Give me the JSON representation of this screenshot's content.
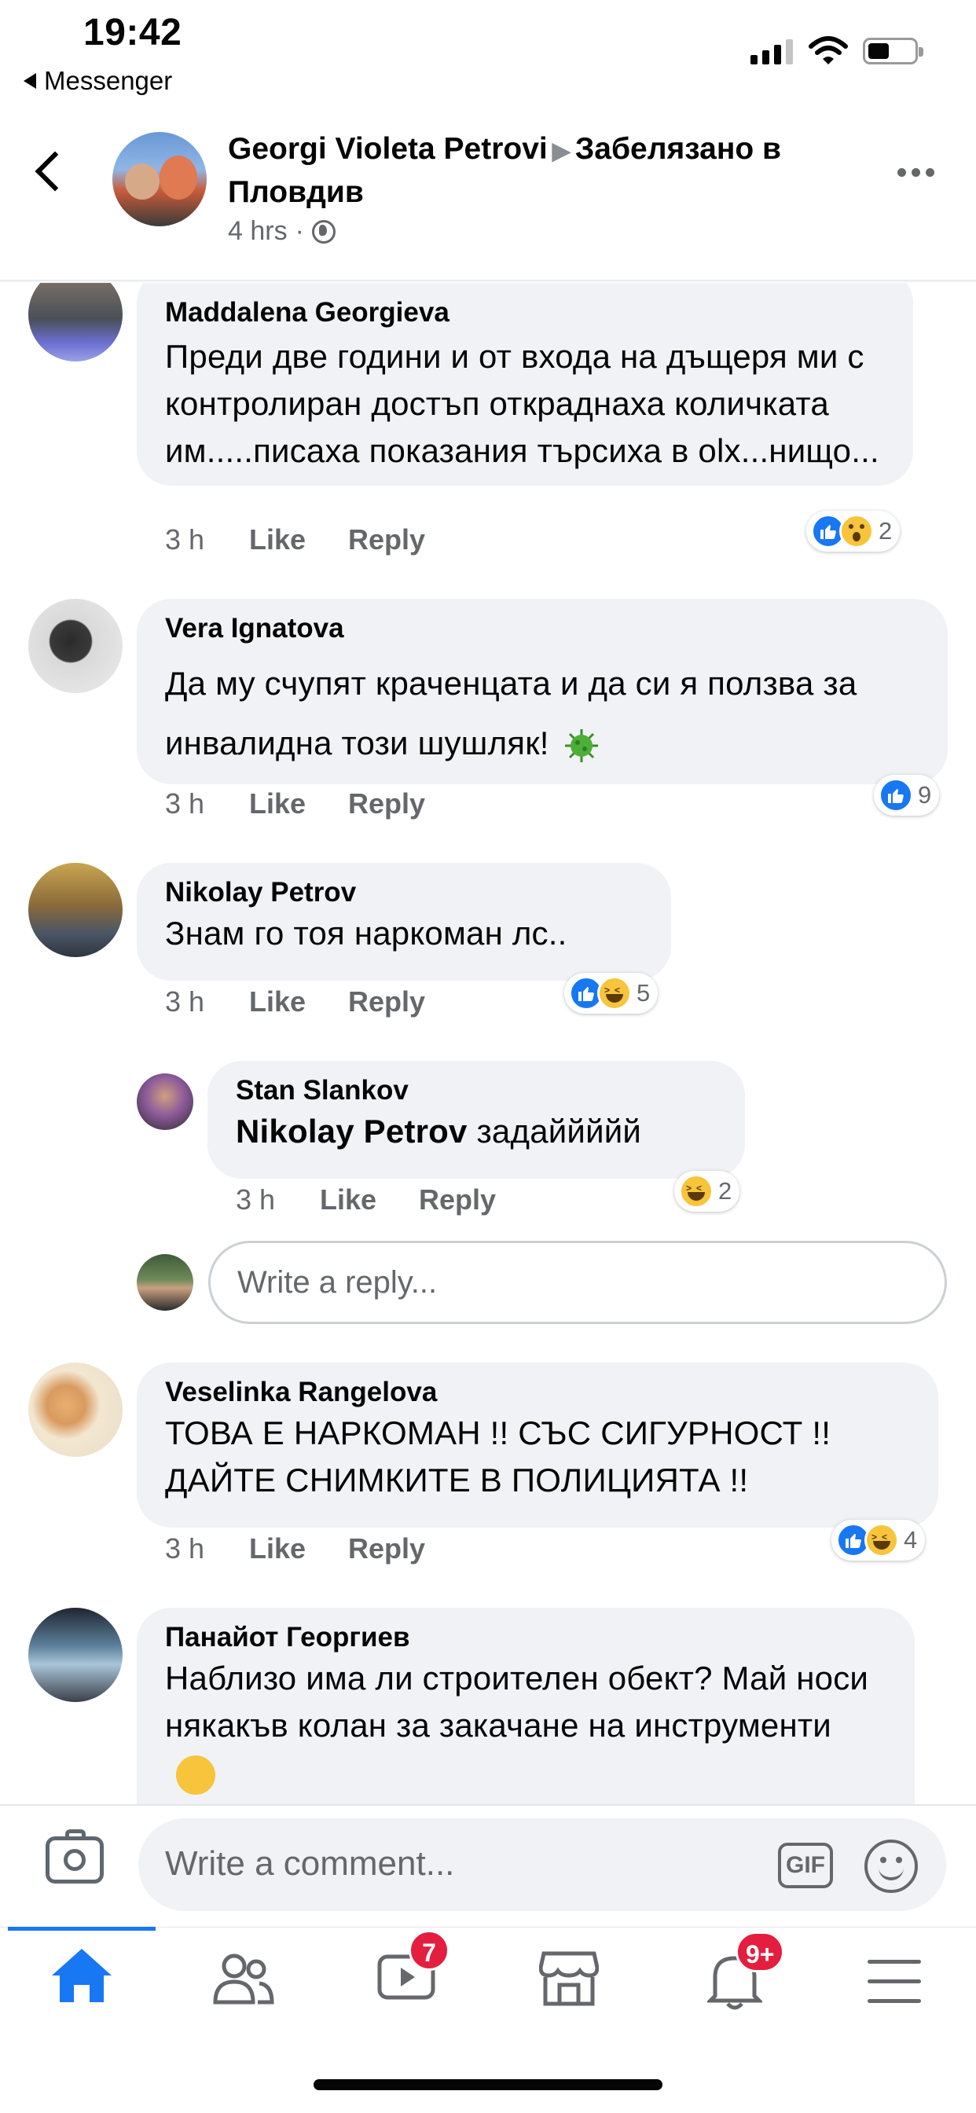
{
  "status_bar": {
    "time": "19:42",
    "back_app": "Messenger"
  },
  "post_header": {
    "author": "Georgi Violeta Petrovi",
    "location_label": "Забелязано в Пловдив",
    "time": "4 hrs",
    "dot": "·"
  },
  "comments": [
    {
      "author": "Maddalena Georgieva",
      "text": "Преди две години и от входа на дъщеря ми с контролиран достъп откраднаха количката им.....писаха показания търсиха в olx...нищо...",
      "time": "3 h",
      "like": "Like",
      "reply": "Reply",
      "reactions": [
        "like",
        "wow"
      ],
      "reaction_count": "2"
    },
    {
      "author": "Vera Ignatova",
      "text": "Да му счупят краченцата и да си я ползва за инвалидна този шушляк!",
      "emoji": "microbe",
      "time": "3 h",
      "like": "Like",
      "reply": "Reply",
      "reactions": [
        "like"
      ],
      "reaction_count": "9"
    },
    {
      "author": "Nikolay Petrov",
      "text": "Знам го тоя наркоман  лс..",
      "time": "3 h",
      "like": "Like",
      "reply": "Reply",
      "reactions": [
        "like",
        "haha"
      ],
      "reaction_count": "5"
    },
    {
      "author": "Stan Slankov",
      "mention": "Nikolay Petrov",
      "text": "задаййййй",
      "time": "3 h",
      "like": "Like",
      "reply": "Reply",
      "reactions": [
        "haha"
      ],
      "reaction_count": "2"
    },
    {
      "author": "Veselinka Rangelova",
      "text": "ТОВА Е НАРКОМАН !! СЪС СИГУРНОСТ !! ДАЙТЕ СНИМКИТЕ В ПОЛИЦИЯТА !!",
      "time": "3 h",
      "like": "Like",
      "reply": "Reply",
      "reactions": [
        "like",
        "haha"
      ],
      "reaction_count": "4"
    },
    {
      "author": "Панайот Георгиев",
      "text": "Наблизо има ли строителен обект? Май носи някакъв колан за закачане на инструменти",
      "emoji": "thinking-face"
    }
  ],
  "reply_box": {
    "placeholder": "Write a reply..."
  },
  "composer": {
    "placeholder": "Write a comment...",
    "gif_label": "GIF"
  },
  "tab_bar": {
    "tabs": [
      {
        "name": "home",
        "active": true
      },
      {
        "name": "friends"
      },
      {
        "name": "watch",
        "badge": "7"
      },
      {
        "name": "marketplace"
      },
      {
        "name": "notifications",
        "badge": "9+"
      },
      {
        "name": "menu"
      }
    ]
  },
  "colors": {
    "accent": "#1877f2",
    "bubble": "#f0f2f5",
    "badge": "#e41e3f",
    "secondary_text": "#65676b"
  }
}
